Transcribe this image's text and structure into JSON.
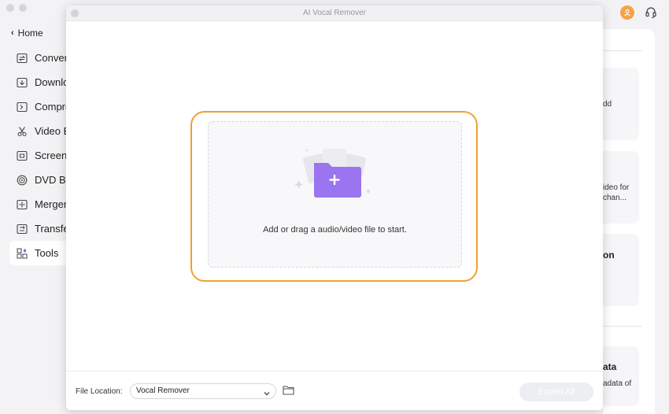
{
  "app": {
    "home_label": "Home",
    "nav": [
      {
        "label": "Convert",
        "icon": "convert-icon"
      },
      {
        "label": "Download",
        "icon": "download-icon"
      },
      {
        "label": "Compress",
        "icon": "compress-icon"
      },
      {
        "label": "Video Editor",
        "icon": "scissors-icon"
      },
      {
        "label": "Screen Recorder",
        "icon": "screen-recorder-icon"
      },
      {
        "label": "DVD Burner",
        "icon": "disc-icon"
      },
      {
        "label": "Merger",
        "icon": "merge-icon"
      },
      {
        "label": "Transfer",
        "icon": "transfer-icon"
      },
      {
        "label": "Tools",
        "icon": "tools-grid-icon",
        "active": true
      }
    ],
    "cards": [
      {
        "desc_lines": [
          "dd"
        ]
      },
      {
        "desc_lines": [
          "ideo for",
          "chan..."
        ]
      },
      {
        "title": "on"
      },
      {
        "title": "ata",
        "desc_lines": [
          "adata of"
        ]
      }
    ]
  },
  "modal": {
    "title": "AI Vocal Remover",
    "drop_text": "Add or drag a audio/video file to start.",
    "file_location_label": "File Location:",
    "file_location_value": "Vocal Remover",
    "export_label": "Export All"
  },
  "colors": {
    "accent_orange": "#F0A030",
    "folder_purple": "#9B74F0",
    "avatar_orange": "#F6A24B"
  }
}
